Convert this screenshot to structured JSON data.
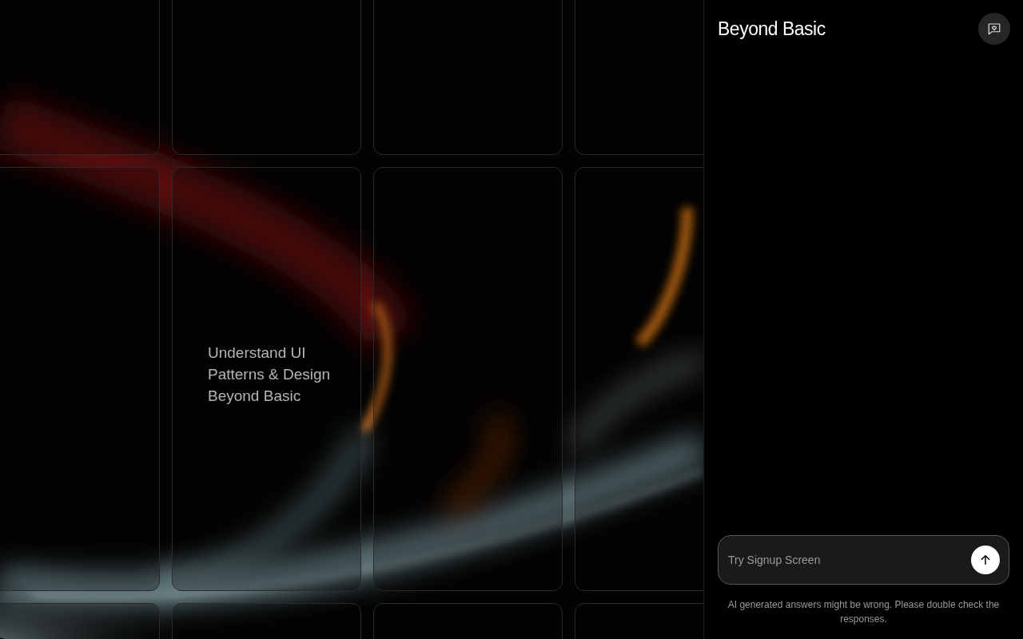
{
  "showcase": {
    "tagline": "Understand UI Patterns & Design Beyond Basic"
  },
  "chat": {
    "title": "Beyond Basic",
    "input": {
      "placeholder": "Try Signup Screen"
    },
    "disclaimer": "AI generated answers might be wrong. Please double check the responses."
  }
}
